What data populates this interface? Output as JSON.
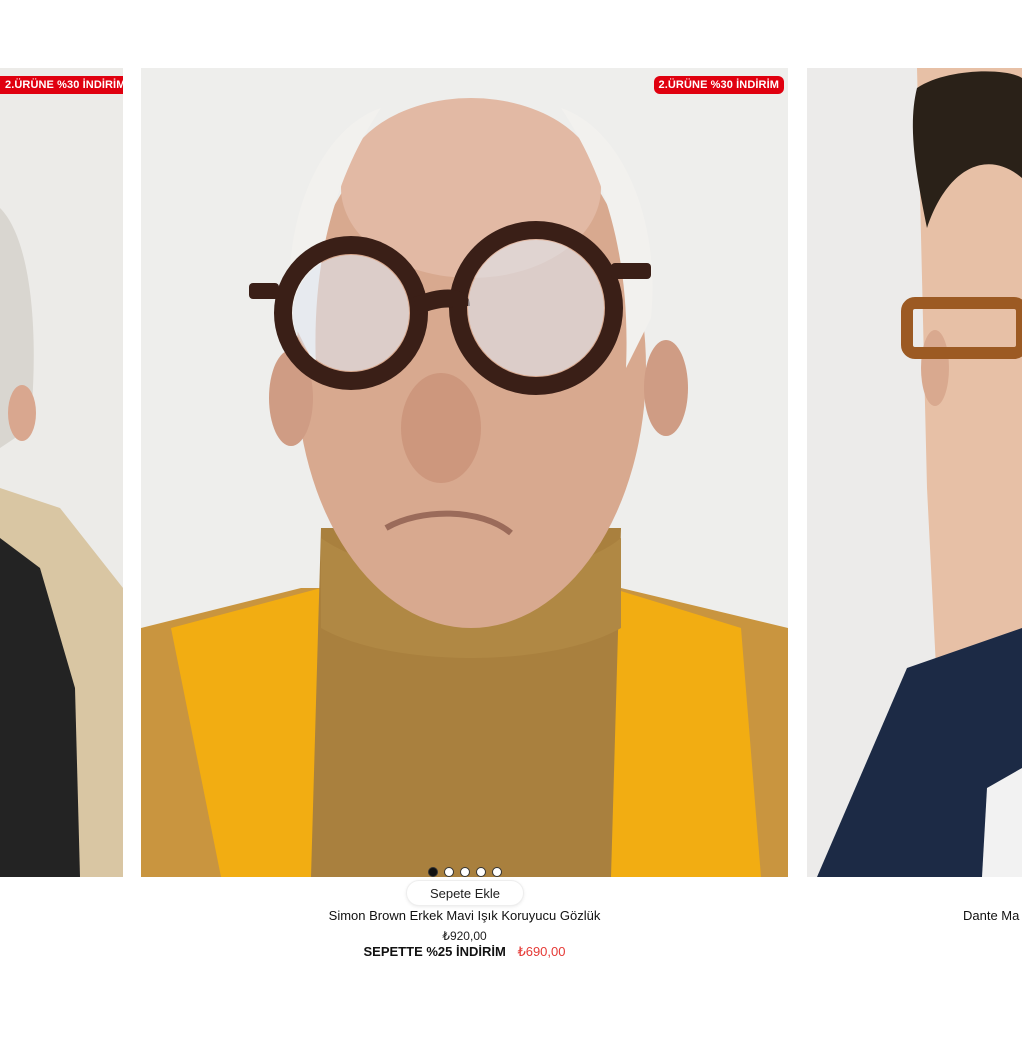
{
  "products": [
    {
      "badge": "2.ÜRÜNE %30 İNDİRİM"
    },
    {
      "badge": "2.ÜRÜNE %30 İNDİRİM",
      "add_to_cart": "Sepete Ekle",
      "title": "Simon Brown Erkek Mavi Işık Koruyucu Gözlük",
      "old_price": "₺920,00",
      "promo_label": "SEPETTE %25 İNDİRİM",
      "promo_price": "₺690,00",
      "image_count": 5,
      "active_image": 1
    },
    {
      "title": "Dante Ma"
    }
  ],
  "colors": {
    "badge_bg": "#e0000f",
    "promo_price": "#e53935",
    "yellow_scarf": "#f2ad12",
    "turtleneck": "#a9803e"
  }
}
